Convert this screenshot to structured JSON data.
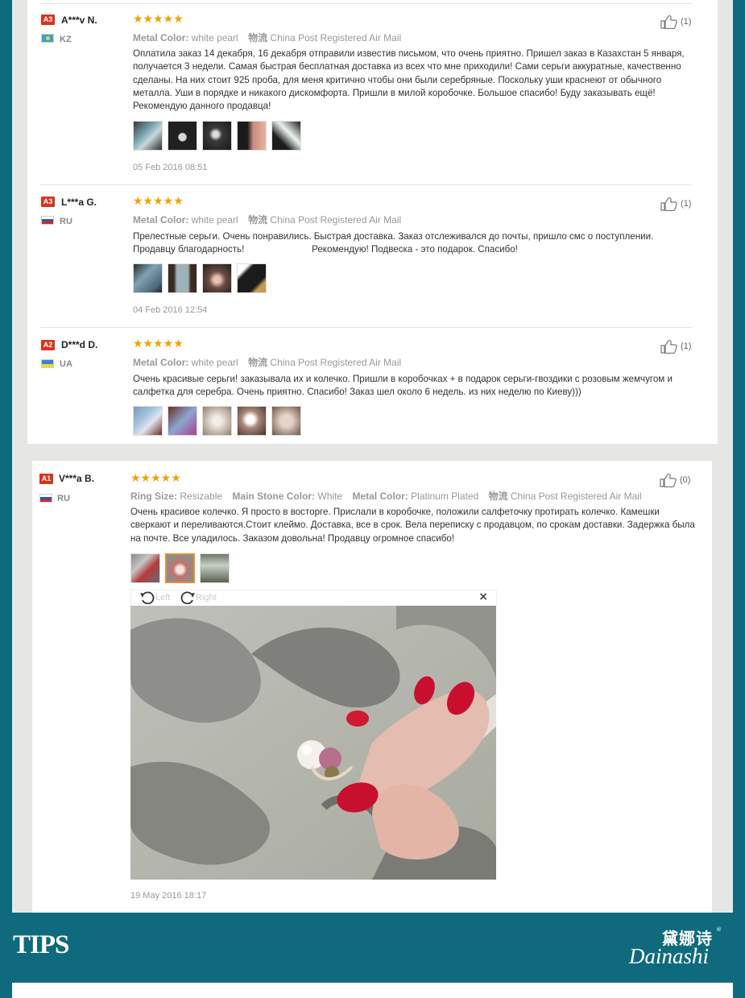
{
  "colors": {
    "accent": "#d9341d",
    "star": "#f5a000",
    "page_bg": "#0f6a7e",
    "muted": "#999999"
  },
  "reviews": [
    {
      "level": "A3",
      "name": "A***v N.",
      "country": "KZ",
      "flag": "kz",
      "stars": "★★★★★",
      "attrs": [
        {
          "label": "Metal Color:",
          "value": "white pearl"
        },
        {
          "label": "物流",
          "value": "China Post Registered Air Mail"
        }
      ],
      "text": "Оплатила заказ 14 декабря, 16 декабря отправили известив письмом, что очень приятно. Пришел заказ в Казахстан 5 января, получается 3 недели. Самая быстрая бесплатная доставка из всех что мне приходили! Сами серьги аккуратные, качественно сделаны. На них стоит 925 проба, для меня критично чтобы они были серебряные. Поскольку уши краснеют от обычного металла. Уши в порядке и никакого дискомфорта. Пришли в милой коробочке. Большое спасибо! Буду заказывать ещё! Рекомендую данного продавца!",
      "date": "05 Feb 2016 08:51",
      "likes": "(1)"
    },
    {
      "level": "A3",
      "name": "L***a G.",
      "country": "RU",
      "flag": "ru",
      "stars": "★★★★★",
      "attrs": [
        {
          "label": "Metal Color:",
          "value": "white pearl"
        },
        {
          "label": "物流",
          "value": "China Post Registered Air Mail"
        }
      ],
      "text": "Прелестные серьги. Очень понравились. Быстрая доставка. Заказ отслеживался до почты, пришло смс о поступлении. Продавцу благодарность!                          Рекомендую! Подвеска - это подарок. Спасибо!",
      "date": "04 Feb 2016 12:54",
      "likes": "(1)"
    },
    {
      "level": "A2",
      "name": "D***d D.",
      "country": "UA",
      "flag": "ua",
      "stars": "★★★★★",
      "attrs": [
        {
          "label": "Metal Color:",
          "value": "white pearl"
        },
        {
          "label": "物流",
          "value": "China Post Registered Air Mail"
        }
      ],
      "text": "Очень красивые серьги! заказывала их и колечко. Пришли в коробочках + в подарок серьги-гвоздики с розовым жемчугом и салфетка для серебра. Очень приятно. Спасибо! Заказ шел около 6 недель. из них неделю по Киеву)))",
      "likes": "(1)"
    },
    {
      "level": "A1",
      "name": "V***a B.",
      "country": "RU",
      "flag": "ru",
      "stars": "★★★★★",
      "attrs": [
        {
          "label": "Ring Size:",
          "value": "Resizable"
        },
        {
          "label": "Main Stone Color:",
          "value": "White"
        },
        {
          "label": "Metal Color:",
          "value": "Platinum Plated"
        },
        {
          "label": "物流",
          "value": "China Post Registered Air Mail"
        }
      ],
      "text": "Очень красивое колечко. Я просто в восторге. Прислали в коробочке, положили салфеточку протирать колечко. Камешки сверкают и переливаются.Стоит клеймо. Доставка, все в срок. Вела переписку с продавцом, по срокам доставки. Задержка была на почте. Все уладилось. Заказом довольна! Продавцу огромное спасибо!",
      "date": "19 May 2016 18:17",
      "likes": "(0)"
    }
  ],
  "viewer": {
    "rotate_left": "Left",
    "rotate_right": "Right",
    "close": "×"
  },
  "footer": {
    "tips": "TIPS",
    "logo_cn": "黛娜诗",
    "logo_reg": "®",
    "logo_en": "Dainashi"
  }
}
